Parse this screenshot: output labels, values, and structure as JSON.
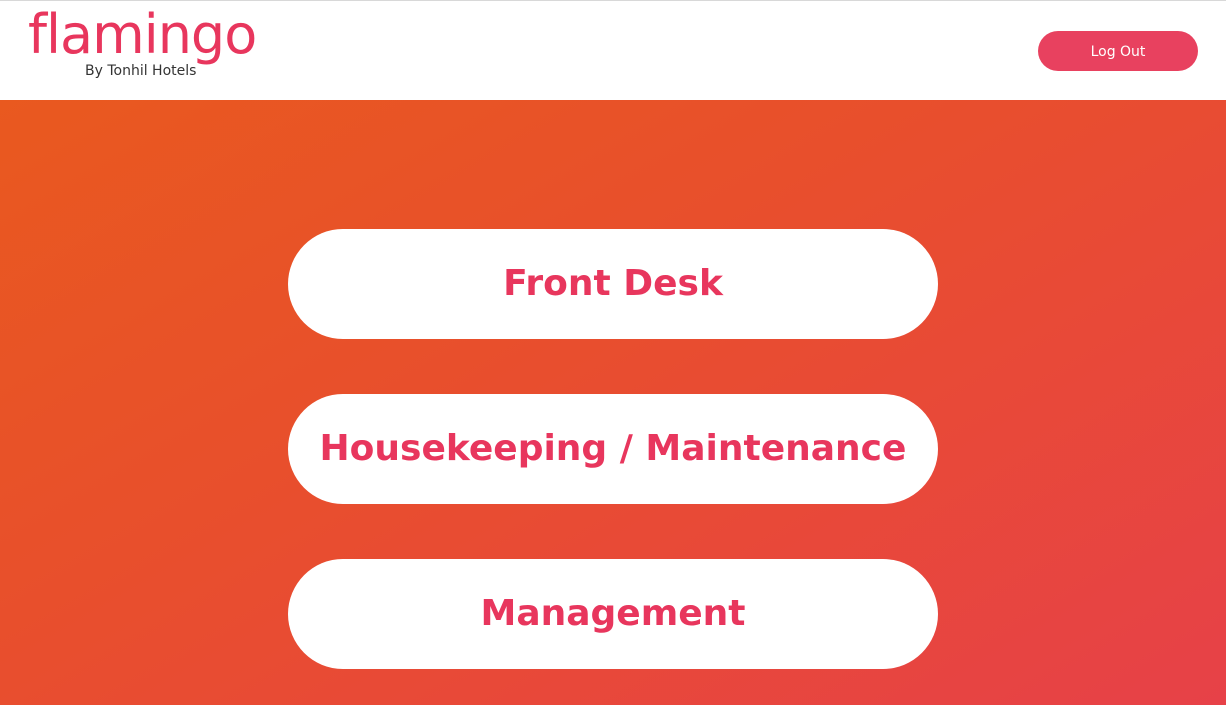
{
  "header": {
    "logo_text": "flamingo",
    "logo_subtitle": "By Tonhil Hotels",
    "logout_label": "Log Out"
  },
  "roles": {
    "front_desk": "Front Desk",
    "housekeeping": "Housekeeping / Maintenance",
    "management": "Management"
  },
  "colors": {
    "brand_pink": "#e8365d",
    "logout_bg": "#e8415f",
    "gradient_start": "#e9591f",
    "gradient_end": "#e74148"
  }
}
